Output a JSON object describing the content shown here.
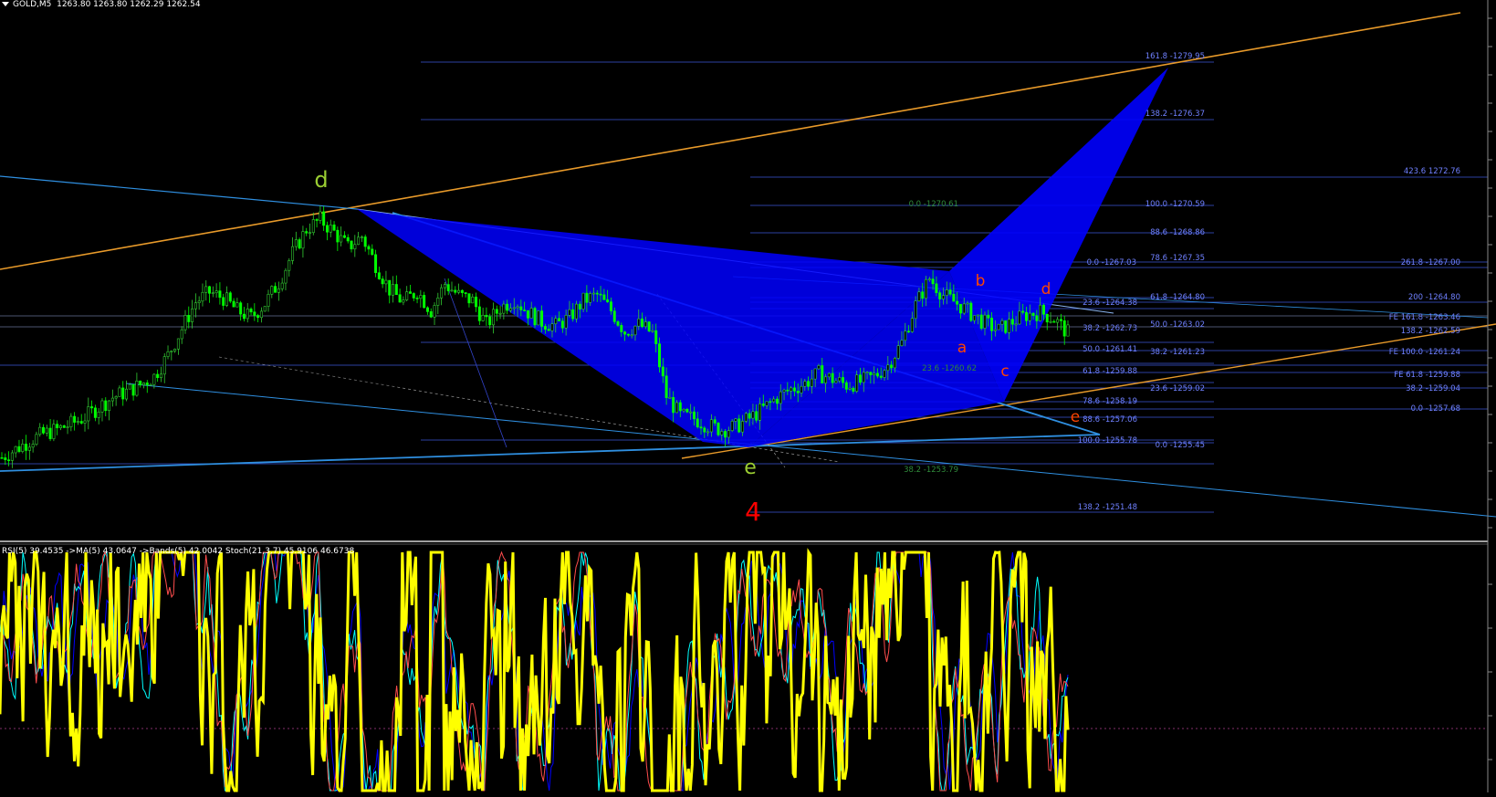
{
  "window": {
    "title": "GOLD,M5",
    "ohlc": "1263.80 1263.80 1262.29 1262.54"
  },
  "indicator": {
    "header": "RSI(5) 39.4535  ->MA(5) 43.0647  ->Bands(5) 42.0042  Stoch(21,3,7) 45.9106 46.6738"
  },
  "wave_labels": [
    {
      "text": "d",
      "color": "#9acd32"
    },
    {
      "text": "e",
      "color": "#9acd32"
    },
    {
      "text": "4",
      "color": "#ff0000"
    },
    {
      "text": "a",
      "color": "#ff4500"
    },
    {
      "text": "b",
      "color": "#ff4500"
    },
    {
      "text": "c",
      "color": "#ff4500"
    },
    {
      "text": "d",
      "color": "#ff4500"
    },
    {
      "text": "e",
      "color": "#ff4500"
    }
  ],
  "fib_labels": [
    {
      "text": "161.8 -1279.95"
    },
    {
      "text": "138.2 -1276.37"
    },
    {
      "text": "423.6  1272.76"
    },
    {
      "text": "0.0 -1270.61"
    },
    {
      "text": "100.0 -1270.59"
    },
    {
      "text": "88.6 -1268.86"
    },
    {
      "text": "0.0 -1267.03"
    },
    {
      "text": "78.6 -1267.35"
    },
    {
      "text": "261.8 -1267.00"
    },
    {
      "text": "61.8 -1264.80"
    },
    {
      "text": "200 -1264.80"
    },
    {
      "text": "23.6 -1264.38"
    },
    {
      "text": "FE 161.8 -1263.46"
    },
    {
      "text": "50.0 -1263.02"
    },
    {
      "text": "38.2 -1262.73"
    },
    {
      "text": "138.2 -1262.59"
    },
    {
      "text": "50.0 -1261.41"
    },
    {
      "text": "38.2 -1261.23"
    },
    {
      "text": "FE 100.0 -1261.24"
    },
    {
      "text": "23.6 -1260.62"
    },
    {
      "text": "61.8 -1259.88"
    },
    {
      "text": "FE 61.8 -1259.88"
    },
    {
      "text": "23.6 -1259.02"
    },
    {
      "text": "38.2 -1259.04"
    },
    {
      "text": "78.6 -1258.19"
    },
    {
      "text": "0.0 -1257.68"
    },
    {
      "text": "88.6 -1257.06"
    },
    {
      "text": "100.0 -1255.78"
    },
    {
      "text": "0.0 -1255.45"
    },
    {
      "text": "38.2 -1253.79"
    },
    {
      "text": "138.2 -1251.48"
    }
  ],
  "colors": {
    "background": "#000000",
    "bull_candle": "#32cd32",
    "bear_candle": "#00ff00",
    "fib_line": "#3a56d6",
    "fib_text": "#6f80ff",
    "trend_orange": "#e89a2a",
    "trend_blue": "#2f8fe0",
    "pattern_fill": "#0000ff",
    "rsi": "#ffff00",
    "stoch_main": "#00ffff",
    "stoch_signal": "#ff4d4d",
    "bands": "#0000ff"
  },
  "chart_data": {
    "type": "line",
    "symbol": "GOLD",
    "timeframe": "M5",
    "price_series_approx": [
      1253.6,
      1254.2,
      1254.8,
      1255.3,
      1255.6,
      1256.0,
      1256.5,
      1257.2,
      1257.9,
      1258.3,
      1258.8,
      1259.4,
      1260.9,
      1262.8,
      1264.7,
      1265.4,
      1265.0,
      1264.1,
      1263.6,
      1264.6,
      1266.1,
      1268.2,
      1269.9,
      1270.6,
      1269.7,
      1268.6,
      1269.4,
      1267.4,
      1265.6,
      1264.7,
      1265.5,
      1264.1,
      1266.0,
      1265.2,
      1264.8,
      1263.1,
      1264.3,
      1264.9,
      1264.0,
      1263.3,
      1263.0,
      1263.6,
      1264.8,
      1265.2,
      1264.1,
      1262.6,
      1263.1,
      1262.5,
      1258.0,
      1256.6,
      1256.4,
      1255.9,
      1255.6,
      1255.8,
      1256.4,
      1257.1,
      1257.9,
      1258.5,
      1258.9,
      1259.6,
      1259.2,
      1258.8,
      1259.0,
      1259.4,
      1260.2,
      1261.8,
      1264.5,
      1266.4,
      1265.2,
      1264.6,
      1263.9,
      1263.2,
      1262.7,
      1263.3,
      1263.8,
      1264.0,
      1263.5,
      1262.5
    ],
    "indicators": [
      {
        "name": "RSI(5)",
        "value": 39.4535
      },
      {
        "name": "MA(5)",
        "value": 43.0647
      },
      {
        "name": "Bands(5)",
        "value": 42.0042
      },
      {
        "name": "Stoch(21,3,7)",
        "main": 45.9106,
        "signal": 46.6738
      }
    ]
  }
}
